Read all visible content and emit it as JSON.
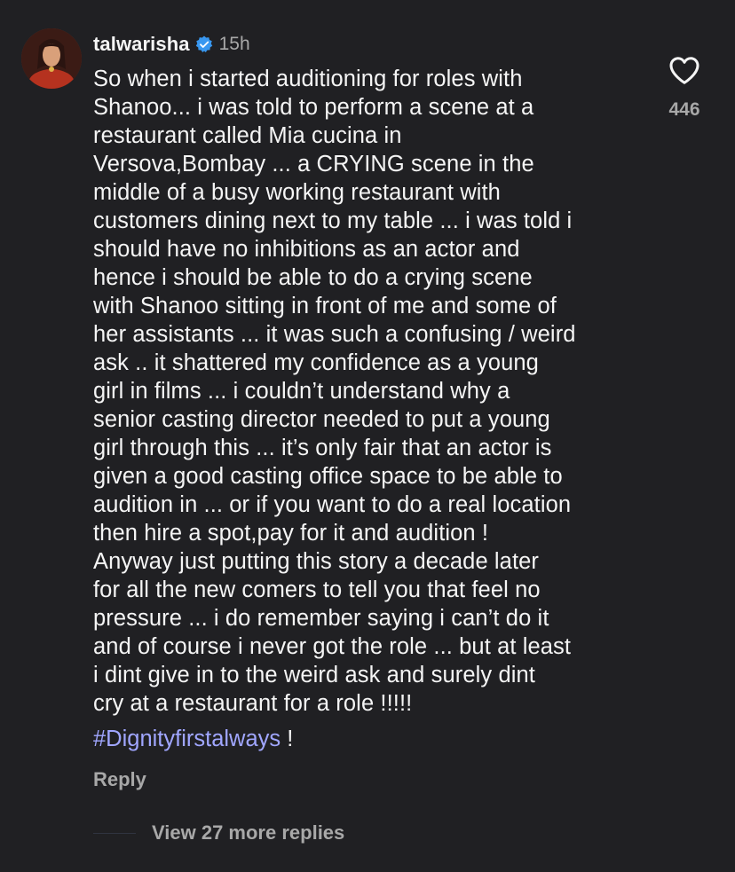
{
  "comment": {
    "username": "talwarisha",
    "timestamp": "15h",
    "verified": true,
    "avatar_icon": "profile-photo",
    "text": "So when i started auditioning for roles with\nShanoo...  i was told to perform a scene at a\nrestaurant called Mia cucina in\nVersova,Bombay ... a CRYING scene in the\nmiddle of a busy working restaurant with\ncustomers dining next to my table ... i was told i\nshould have no inhibitions as an actor and\nhence i should be able to do a crying scene\nwith Shanoo sitting in front of me and some of\nher assistants ... it was such a confusing / weird\nask .. it shattered my confidence as a young\ngirl in films ... i couldn’t understand why a\nsenior casting director needed to put a young\ngirl through this ... it’s only fair that an actor is\ngiven a good casting office space to be able to\naudition in ... or if you want to do a real location\nthen hire a spot,pay for it and audition !\nAnyway just putting this story a decade later\nfor all the new comers to tell you that feel no\npressure ... i do remember saying i can’t do it\nand of course i never got the role ... but at least\ni dint give in to the weird ask and surely dint\ncry at a restaurant for a role !!!!!",
    "hashtag": "#Dignityfirstalways",
    "hashtag_suffix": " !",
    "reply_label": "Reply",
    "like_count": "446",
    "view_replies_label": "View 27 more replies"
  },
  "colors": {
    "background": "#202023",
    "primary_text": "#f5f5f5",
    "secondary_text": "#a8a8a8",
    "hashtag": "#a0a6ff",
    "verified_badge": "#3897f0"
  },
  "icons": {
    "verified": "verified-badge-icon",
    "like": "heart-outline-icon"
  }
}
